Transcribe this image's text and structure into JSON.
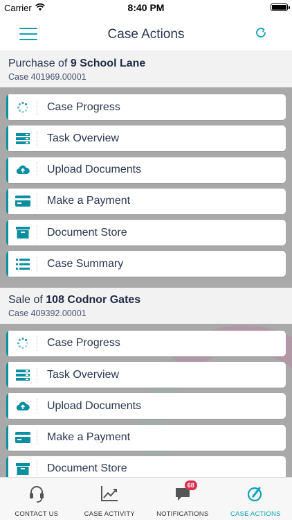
{
  "status_bar": {
    "carrier": "Carrier",
    "time": "8:40 PM"
  },
  "header": {
    "title": "Case Actions"
  },
  "cases": [
    {
      "prefix": "Purchase of",
      "address": "9 School Lane",
      "reference": "Case 401969.00001",
      "actions": [
        {
          "label": "Case Progress",
          "icon": "progress-spinner-icon"
        },
        {
          "label": "Task Overview",
          "icon": "task-list-icon"
        },
        {
          "label": "Upload Documents",
          "icon": "cloud-upload-icon"
        },
        {
          "label": "Make a Payment",
          "icon": "credit-card-icon"
        },
        {
          "label": "Document Store",
          "icon": "archive-box-icon"
        },
        {
          "label": "Case Summary",
          "icon": "list-icon"
        }
      ]
    },
    {
      "prefix": "Sale of",
      "address": "108 Codnor Gates",
      "reference": "Case 409392.00001",
      "actions": [
        {
          "label": "Case Progress",
          "icon": "progress-spinner-icon"
        },
        {
          "label": "Task Overview",
          "icon": "task-list-icon"
        },
        {
          "label": "Upload Documents",
          "icon": "cloud-upload-icon"
        },
        {
          "label": "Make a Payment",
          "icon": "credit-card-icon"
        },
        {
          "label": "Document Store",
          "icon": "archive-box-icon"
        }
      ]
    }
  ],
  "tabs": [
    {
      "label": "CONTACT US",
      "icon": "headset-icon",
      "active": false
    },
    {
      "label": "CASE ACTIVITY",
      "icon": "trend-chart-icon",
      "active": false
    },
    {
      "label": "NOTIFICATIONS",
      "icon": "chat-bubble-icon",
      "active": false,
      "badge": "68"
    },
    {
      "label": "CASE ACTIONS",
      "icon": "edit-pencil-icon",
      "active": true
    }
  ],
  "colors": {
    "accent": "#0aa3b5",
    "accent_dark": "#0a8fa0",
    "badge": "#d9304f",
    "text": "#2a3550"
  }
}
